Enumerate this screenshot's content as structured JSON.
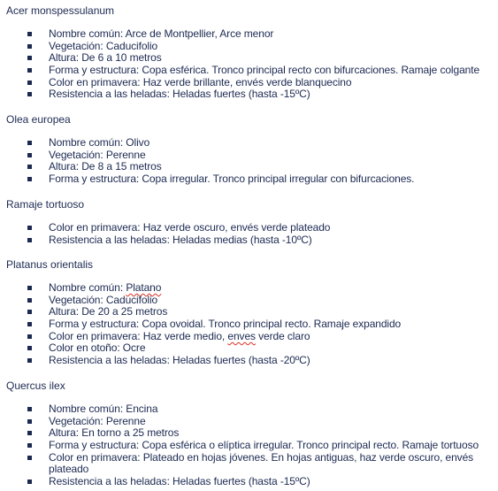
{
  "sections": [
    {
      "title": "Acer monspessulanum",
      "items": [
        "Nombre común: Arce de Montpellier, Arce menor",
        "Vegetación: Caducifolio",
        "Altura: De 6 a 10 metros",
        "Forma y estructura: Copa esférica. Tronco principal recto con bifurcaciones. Ramaje colgante",
        "Color en primavera: Haz verde brillante, envés verde blanquecino",
        "Resistencia a las heladas: Heladas fuertes (hasta -15ºC)"
      ]
    },
    {
      "title": "Olea europea",
      "items": [
        "Nombre común: Olivo",
        "Vegetación: Perenne",
        "Altura: De 8 a 15 metros",
        "Forma y estructura: Copa irregular. Tronco principal irregular con bifurcaciones."
      ]
    },
    {
      "title": "Ramaje tortuoso",
      "items": [
        "Color en primavera: Haz verde oscuro, envés verde plateado",
        "Resistencia a las heladas: Heladas medias (hasta -10ºC)"
      ]
    },
    {
      "title": "Platanus orientalis",
      "items": [
        "Nombre común: ",
        "Vegetación: Caducifolio",
        "Altura: De 20 a 25 metros",
        "Forma y estructura: Copa ovoidal. Tronco principal recto. Ramaje expandido",
        "Color en primavera: Haz verde medio, ",
        "Color en otoño: Ocre",
        "Resistencia a las heladas: Heladas fuertes (hasta -20ºC)"
      ],
      "spell_words": {
        "platano": "Platano",
        "enves": "enves",
        "enves_rest": " verde claro"
      }
    },
    {
      "title": "Quercus ilex",
      "items": [
        "Nombre común: Encina",
        "Vegetación: Perenne",
        "Altura: En torno a 25 metros",
        "Forma y estructura: Copa esférica o elíptica irregular. Tronco principal recto. Ramaje tortuoso",
        "Color en primavera: Plateado en hojas jóvenes. En hojas antiguas, haz verde oscuro, envés plateado",
        "Resistencia a las heladas: Heladas fuertes (hasta -15ºC)"
      ]
    }
  ]
}
